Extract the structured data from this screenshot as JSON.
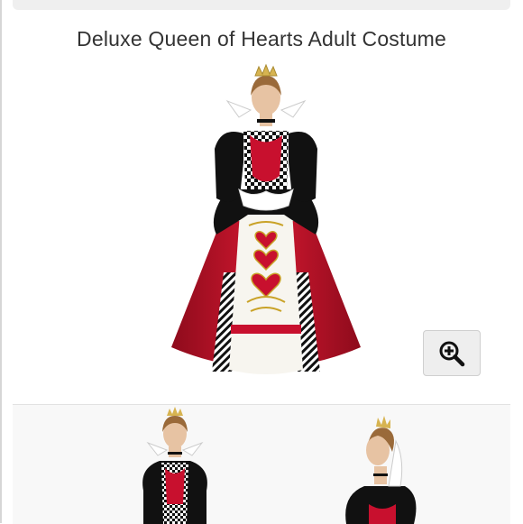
{
  "product": {
    "title": "Deluxe Queen of Hearts Adult Costume"
  },
  "gallery": {
    "zoom_icon": "zoom-in-icon",
    "thumbnails": [
      {
        "name": "thumbnail-front-view"
      },
      {
        "name": "thumbnail-side-view"
      }
    ]
  },
  "colors": {
    "costume_red": "#c8102e",
    "costume_black": "#111111",
    "zoom_button_bg": "#eeeeee"
  }
}
